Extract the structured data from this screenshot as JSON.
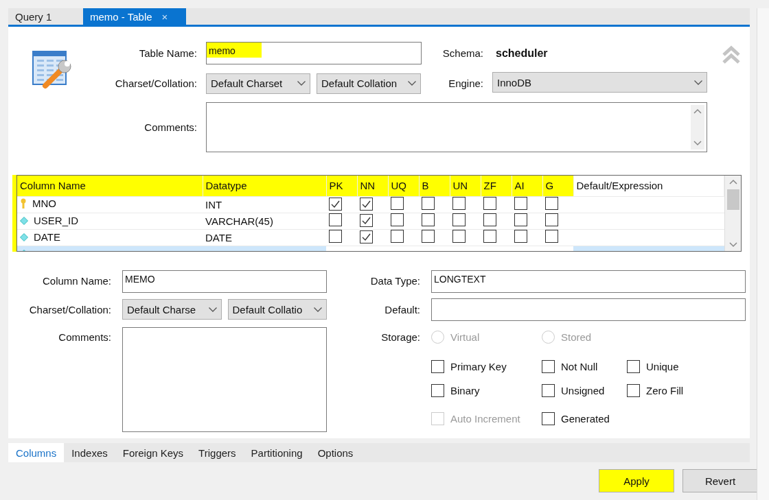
{
  "tabs": [
    {
      "label": "Query 1",
      "selected": false
    },
    {
      "label": "memo - Table",
      "selected": true,
      "close": "×"
    }
  ],
  "table_form": {
    "name_label": "Table Name:",
    "name_value": "memo",
    "name_highlighted": true,
    "charset_label": "Charset/Collation:",
    "charset": "Default Charset",
    "collation": "Default Collation",
    "comments_label": "Comments:",
    "schema_label": "Schema:",
    "schema": "scheduler",
    "engine_label": "Engine:",
    "engine": "InnoDB"
  },
  "grid": {
    "highlighted": true,
    "columns": [
      {
        "label": "Column Name",
        "highlighted": true
      },
      {
        "label": "Datatype",
        "highlighted": true
      },
      {
        "label": "PK",
        "highlighted": true
      },
      {
        "label": "NN",
        "highlighted": true
      },
      {
        "label": "UQ",
        "highlighted": true
      },
      {
        "label": "B",
        "highlighted": true
      },
      {
        "label": "UN",
        "highlighted": true
      },
      {
        "label": "ZF",
        "highlighted": true
      },
      {
        "label": "AI",
        "highlighted": true
      },
      {
        "label": "G",
        "highlighted": true
      },
      {
        "label": "Default/Expression",
        "highlighted": false
      }
    ],
    "rows": [
      {
        "kind": "key",
        "name": "MNO",
        "type": "INT",
        "selected": false,
        "flags": [
          true,
          true,
          false,
          false,
          false,
          false,
          false,
          false
        ]
      },
      {
        "kind": "column",
        "name": "USER_ID",
        "type": "VARCHAR(45)",
        "selected": false,
        "flags": [
          false,
          true,
          false,
          false,
          false,
          false,
          false,
          false
        ]
      },
      {
        "kind": "column",
        "name": "DATE",
        "type": "DATE",
        "selected": false,
        "flags": [
          false,
          true,
          false,
          false,
          false,
          false,
          false,
          false
        ]
      },
      {
        "kind": "column",
        "selected": true
      }
    ]
  },
  "column_form": {
    "name_label": "Column Name:",
    "name_value": "MEMO",
    "charset_label": "Charset/Collation:",
    "charset": "Default Charse",
    "collation": "Default Collatio",
    "comments_label": "Comments:",
    "type_label": "Data Type:",
    "type_value": "LONGTEXT",
    "default_label": "Default:",
    "storage_label": "Storage:",
    "storage": [
      {
        "label": "Virtual",
        "selected": false,
        "disabled": true
      },
      {
        "label": "Stored",
        "selected": false,
        "disabled": true
      }
    ],
    "options": [
      {
        "label": "Primary Key",
        "checked": false,
        "disabled": false
      },
      {
        "label": "Not Null",
        "checked": false,
        "disabled": false
      },
      {
        "label": "Unique",
        "checked": false,
        "disabled": false
      },
      {
        "label": "Binary",
        "checked": false,
        "disabled": false
      },
      {
        "label": "Unsigned",
        "checked": false,
        "disabled": false
      },
      {
        "label": "Zero Fill",
        "checked": false,
        "disabled": false
      },
      {
        "label": "Auto Increment",
        "checked": false,
        "disabled": true
      },
      {
        "label": "Generated",
        "checked": false,
        "disabled": false
      }
    ]
  },
  "bottom_tabs": [
    {
      "label": "Columns",
      "selected": true
    },
    {
      "label": "Indexes",
      "selected": false
    },
    {
      "label": "Foreign Keys",
      "selected": false
    },
    {
      "label": "Triggers",
      "selected": false
    },
    {
      "label": "Partitioning",
      "selected": false
    },
    {
      "label": "Options",
      "selected": false
    }
  ],
  "buttons": [
    {
      "label": "Apply",
      "highlighted": true
    },
    {
      "label": "Revert",
      "highlighted": false
    }
  ]
}
